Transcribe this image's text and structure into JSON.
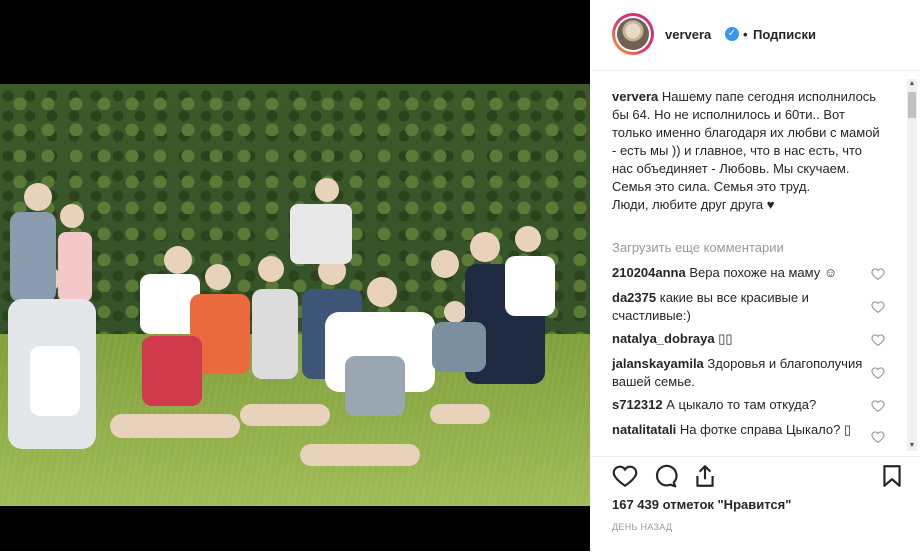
{
  "post": {
    "username": "ververa",
    "follow_label": "Подписки",
    "caption_user": "ververa",
    "caption_text": "Нашему папе сегодня исполнилось бы 64. Но не исполнилось и 60ти.. Вот только именно благодаря их любви с мамой - есть мы )) и главное, что в нас есть, что нас объединяет - Любовь. Мы скучаем.",
    "caption_line2": "Семья это сила. Семья это труд.",
    "caption_line3": "Люди, любите друг друга ♥",
    "load_more": "Загрузить еще комментарии",
    "likes": "167 439 отметок \"Нравится\"",
    "time": "ДЕНЬ НАЗАД"
  },
  "comments": [
    {
      "user": "210204anna",
      "text": "Вера похоже на маму ☺"
    },
    {
      "user": "da2375",
      "text": "какие вы все красивые и счастливые:)"
    },
    {
      "user": "natalya_dobraya",
      "text": "▯▯"
    },
    {
      "user": "jalanskayamila",
      "text": "Здоровья и благополучия вашей семье."
    },
    {
      "user": "s712312",
      "text": "А цыкало то там откуда?"
    },
    {
      "user": "natalitatali",
      "text": "На фотке справа Цыкало? ▯"
    }
  ],
  "icons": {
    "verified": "verified-badge-icon",
    "like": "heart-icon",
    "comment": "comment-icon",
    "share": "share-icon",
    "save": "bookmark-icon"
  },
  "colors": {
    "verified": "#3897f0",
    "muted": "#999999",
    "text": "#262626"
  }
}
